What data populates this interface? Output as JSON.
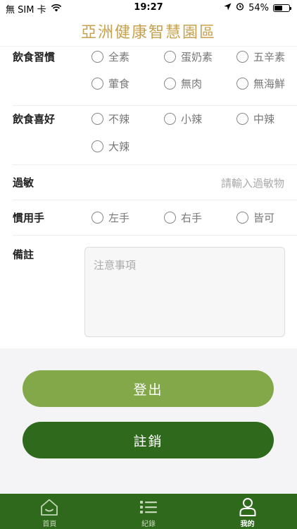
{
  "status": {
    "carrier": "無 SIM 卡",
    "time": "19:27",
    "battery": "54%",
    "battery_level": 0.54
  },
  "header": {
    "title": "亞洲健康智慧園區"
  },
  "form": {
    "diet_habit": {
      "label": "飲食習慣",
      "options": [
        "全素",
        "蛋奶素",
        "五辛素",
        "葷食",
        "無肉",
        "無海鮮"
      ]
    },
    "diet_pref": {
      "label": "飲食喜好",
      "options": [
        "不辣",
        "小辣",
        "中辣",
        "大辣"
      ]
    },
    "allergy": {
      "label": "過敏",
      "placeholder": "請輸入過敏物"
    },
    "hand": {
      "label": "慣用手",
      "options": [
        "左手",
        "右手",
        "皆可"
      ]
    },
    "note": {
      "label": "備註",
      "placeholder": "注意事項"
    }
  },
  "buttons": {
    "login": "登出",
    "logout": "註銷"
  },
  "tabs": [
    {
      "label": "首頁",
      "icon": "home-icon",
      "active": false
    },
    {
      "label": "紀錄",
      "icon": "list-icon",
      "active": false
    },
    {
      "label": "我的",
      "icon": "user-icon",
      "active": true
    }
  ],
  "colors": {
    "title": "#c7a14d",
    "btn_light": "#83a84a",
    "btn_dark": "#2f6a1c",
    "tab_bg": "#2f6a1c"
  }
}
